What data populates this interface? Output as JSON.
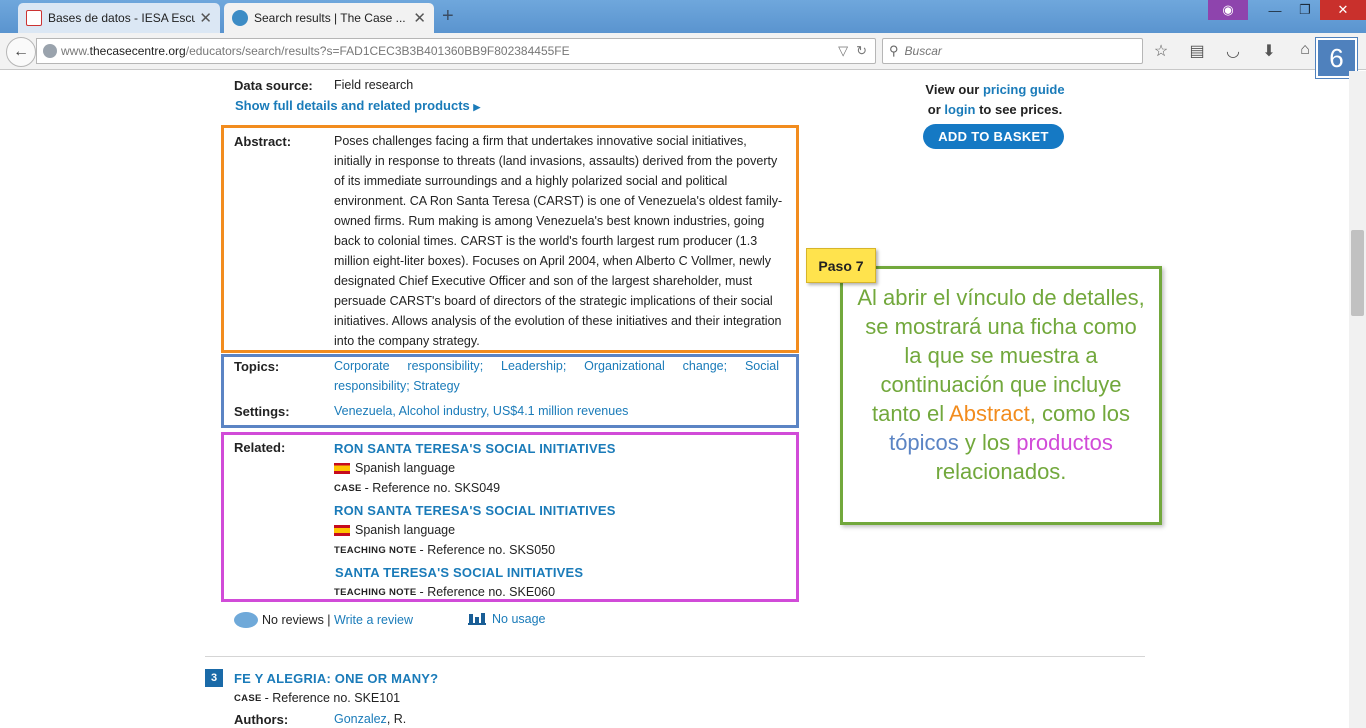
{
  "browser": {
    "tabs": [
      {
        "title": "Bases de datos - IESA Escu...",
        "active": false
      },
      {
        "title": "Search results | The Case ...",
        "active": true
      }
    ],
    "url_prefix": "www.",
    "url_host": "thecasecentre.org",
    "url_path": "/educators/search/results?s=FAD1CEC3B3B401360BB9F802384455FE",
    "search_placeholder": "Buscar",
    "step_number": "6"
  },
  "case": {
    "data_source_label": "Data source:",
    "data_source_value": "Field research",
    "show_details_link": "Show full details and related products",
    "abstract_label": "Abstract:",
    "abstract_text": "Poses challenges facing a firm that undertakes innovative social initiatives, initially in response to threats (land invasions, assaults) derived from the poverty of its immediate surroundings and a highly polarized social and political environment. CA Ron Santa Teresa (CARST) is one of Venezuela's oldest family-owned firms. Rum making is among Venezuela's best known industries, going back to colonial times. CARST is the world's fourth largest rum producer (1.3 million eight-liter boxes). Focuses on April 2004, when Alberto C Vollmer, newly designated Chief Executive Officer and son of the largest shareholder, must persuade CARST's board of directors of the strategic implications of their social initiatives. Allows analysis of the evolution of these initiatives and their integration into the company strategy.",
    "topics_label": "Topics:",
    "topics": [
      "Corporate responsibility",
      "Leadership",
      "Organizational change",
      "Social responsibility",
      "Strategy"
    ],
    "settings_label": "Settings:",
    "settings": [
      "Venezuela",
      "Alcohol industry",
      "US$4.1 million revenues"
    ],
    "related_label": "Related:",
    "related": [
      {
        "title": "RON SANTA TERESA'S SOCIAL INITIATIVES",
        "language": "Spanish language",
        "type": "CASE",
        "ref": "Reference no. SKS049"
      },
      {
        "title": "RON SANTA TERESA'S SOCIAL INITIATIVES",
        "language": "Spanish language",
        "type": "TEACHING NOTE",
        "ref": "Reference no. SKS050"
      },
      {
        "title": "SANTA TERESA'S SOCIAL INITIATIVES",
        "language": "",
        "type": "TEACHING NOTE",
        "ref": "Reference no. SKE060"
      }
    ],
    "reviews_text": "No reviews |",
    "write_review": "Write a review",
    "usage_text": "No usage"
  },
  "pricing": {
    "line1_prefix": "View our",
    "pricing_link": "pricing guide",
    "line2_prefix": "or",
    "login_link": "login",
    "line2_suffix": "to see prices.",
    "basket_button": "ADD TO BASKET"
  },
  "tutorial": {
    "step_label": "Paso 7",
    "callout_part1": "Al abrir el vínculo de detalles, se mostrará una ficha como la que se muestra a continuación que incluye tanto el",
    "callout_abstract": "Abstract",
    "callout_part2": ", como los",
    "callout_topicos": "tópicos",
    "callout_part3": "y los",
    "callout_productos": "productos",
    "callout_part4": "relacionados.",
    "colors": {
      "abstract": "#f28c1e",
      "topics": "#5b84c4",
      "related": "#d14bd8",
      "callout": "#72a83c"
    }
  },
  "next_result": {
    "number": "3",
    "title": "FE Y ALEGRIA: ONE OR MANY?",
    "type": "CASE",
    "ref": "Reference no. SKE101",
    "authors_label": "Authors:",
    "author": "Gonzalez",
    "author_suffix": ", R."
  }
}
